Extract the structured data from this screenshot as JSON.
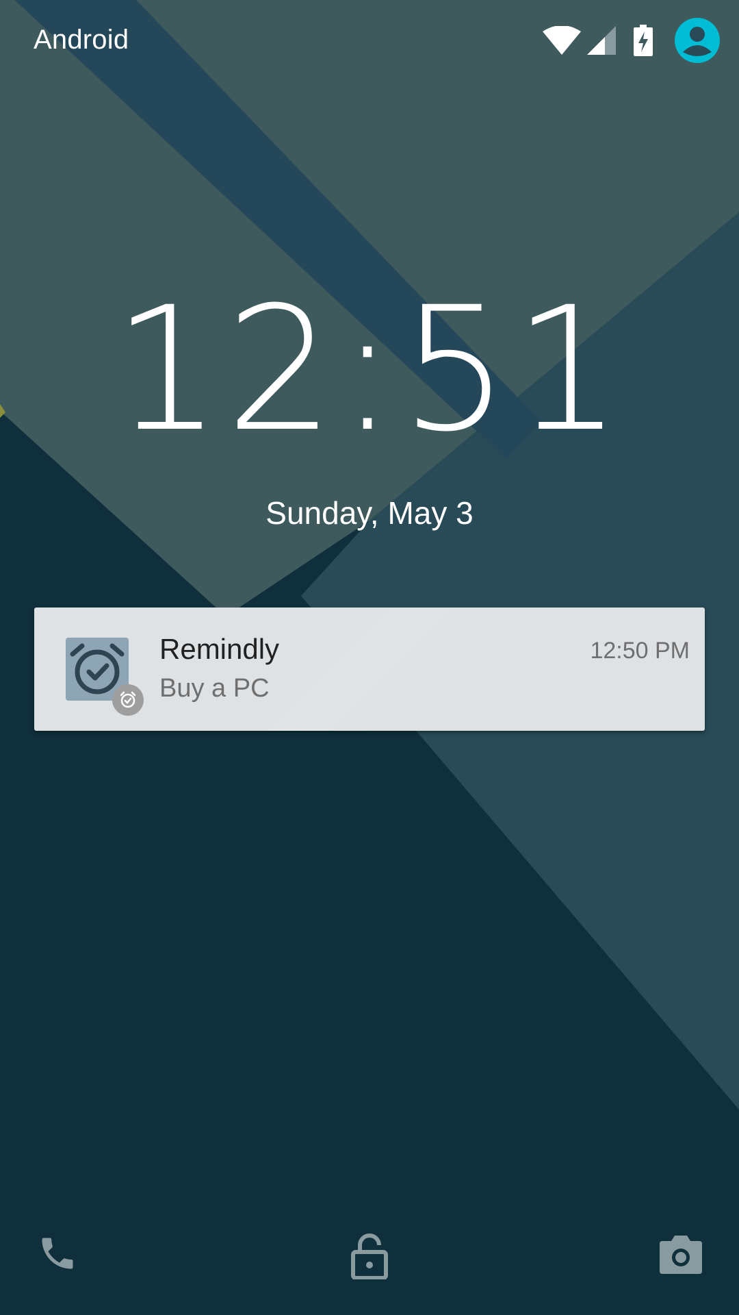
{
  "status_bar": {
    "carrier": "Android",
    "icons": [
      "wifi-icon",
      "cell-signal-icon",
      "battery-charging-icon",
      "user-avatar-icon"
    ],
    "avatar_color": "#00bcd4"
  },
  "lockscreen": {
    "time": "12:51",
    "date": "Sunday, May 3"
  },
  "notification": {
    "app_name": "Remindly",
    "text": "Buy a PC",
    "time": "12:50 PM",
    "icon": "alarm-check-icon",
    "badge_icon": "alarm-small-icon"
  },
  "bottom_bar": {
    "icons": [
      "phone-icon",
      "lock-icon",
      "camera-icon"
    ]
  },
  "colors": {
    "wallpaper_light": "#3f5a5d",
    "wallpaper_band": "#25475a",
    "wallpaper_dark": "#0f2f3c",
    "card_bg": "#dfe2e5"
  }
}
